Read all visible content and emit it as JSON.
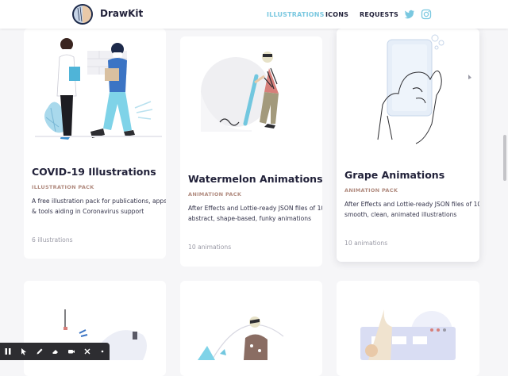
{
  "header": {
    "brand": "DrawKit",
    "nav": [
      "ILLUSTRATIONS",
      "ICONS",
      "REQUESTS"
    ],
    "social": [
      "twitter-icon",
      "instagram-icon"
    ],
    "colors": {
      "accent": "#7ac8e0",
      "dark": "#22223a"
    }
  },
  "cards": [
    {
      "title": "COVID-19 Illustrations",
      "kind": "ILLUSTRATION PACK",
      "desc": "A free illustration pack for publications, apps, & tools aiding in Coronavirus support",
      "count": "6 illustrations"
    },
    {
      "title": "Watermelon Animations",
      "kind": "ANIMATION PACK",
      "desc": "After Effects and Lottie-ready JSON files of 10 abstract, shape-based, funky animations",
      "count": "10 animations"
    },
    {
      "title": "Grape Animations",
      "kind": "ANIMATION PACK",
      "desc": "After Effects and Lottie-ready JSON files of 10 smooth, clean, animated illustrations",
      "count": "10 animations"
    }
  ],
  "toolbar": [
    "pause-icon",
    "cursor-icon",
    "pen-icon",
    "eraser-icon",
    "camera-icon",
    "close-icon",
    "more-icon"
  ]
}
